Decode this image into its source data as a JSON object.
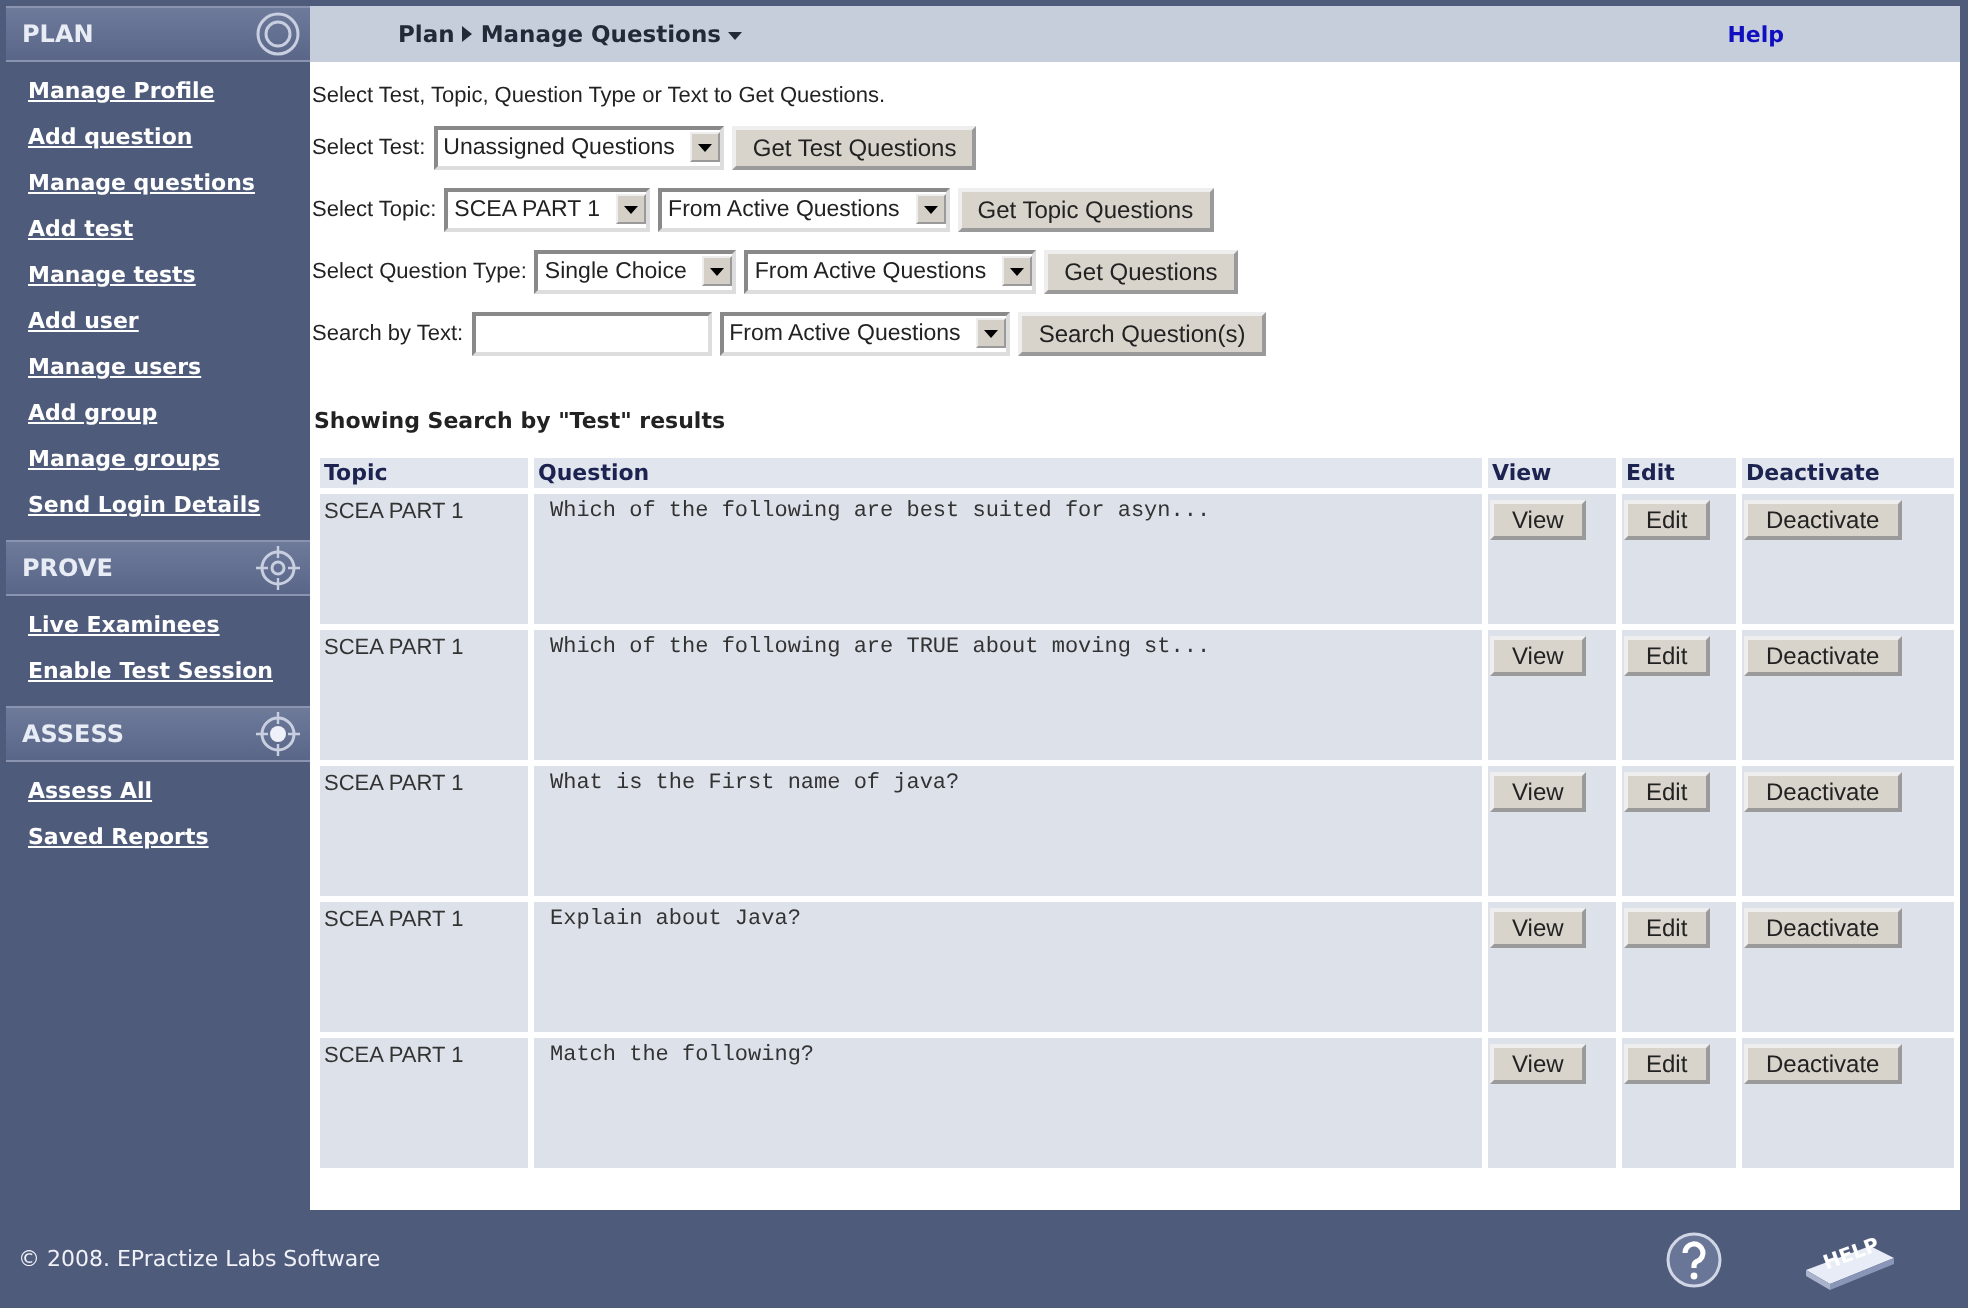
{
  "sidebar": {
    "sections": [
      {
        "title": "PLAN",
        "items": [
          {
            "label": "Manage Profile"
          },
          {
            "label": "Add question"
          },
          {
            "label": "Manage questions"
          },
          {
            "label": "Add test"
          },
          {
            "label": "Manage tests"
          },
          {
            "label": "Add user"
          },
          {
            "label": "Manage users"
          },
          {
            "label": "Add group"
          },
          {
            "label": "Manage groups"
          },
          {
            "label": "Send Login Details"
          }
        ]
      },
      {
        "title": "PROVE",
        "items": [
          {
            "label": "Live Examinees"
          },
          {
            "label": "Enable Test Session"
          }
        ]
      },
      {
        "title": "ASSESS",
        "items": [
          {
            "label": "Assess All"
          },
          {
            "label": "Saved Reports"
          }
        ]
      }
    ]
  },
  "breadcrumb": {
    "parent": "Plan",
    "current": "Manage Questions"
  },
  "help_link": "Help",
  "instructions": "Select Test, Topic, Question Type or Text to Get Questions.",
  "form_rows": [
    {
      "label": "Select Test:",
      "controls": [
        {
          "kind": "select",
          "value": "Unassigned Questions"
        },
        {
          "kind": "button",
          "label": "Get Test Questions"
        }
      ]
    },
    {
      "label": "Select Topic:",
      "controls": [
        {
          "kind": "select",
          "value": "SCEA PART 1"
        },
        {
          "kind": "select",
          "value": "From Active Questions"
        },
        {
          "kind": "button",
          "label": "Get Topic Questions"
        }
      ]
    },
    {
      "label": "Select Question Type:",
      "controls": [
        {
          "kind": "select",
          "value": "Single Choice"
        },
        {
          "kind": "select",
          "value": "From Active Questions"
        },
        {
          "kind": "button",
          "label": "Get Questions"
        }
      ]
    },
    {
      "label": "Search by Text:",
      "controls": [
        {
          "kind": "input"
        },
        {
          "kind": "select",
          "value": "From Active Questions"
        },
        {
          "kind": "button",
          "label": "Search Question(s)"
        }
      ]
    }
  ],
  "results_heading": "Showing Search by \"Test\" results",
  "table": {
    "columns": [
      "Topic",
      "Question",
      "View",
      "Edit",
      "Deactivate"
    ],
    "rows": [
      {
        "topic": "SCEA PART 1",
        "question": "Which of the following are best suited for asyn...",
        "view": "View",
        "edit": "Edit",
        "deactivate": "Deactivate"
      },
      {
        "topic": "SCEA PART 1",
        "question": "Which of the following are TRUE about moving st...",
        "view": "View",
        "edit": "Edit",
        "deactivate": "Deactivate"
      },
      {
        "topic": "SCEA PART 1",
        "question": "What is the First name of java?",
        "view": "View",
        "edit": "Edit",
        "deactivate": "Deactivate"
      },
      {
        "topic": "SCEA PART 1",
        "question": "Explain about Java?",
        "view": "View",
        "edit": "Edit",
        "deactivate": "Deactivate"
      },
      {
        "topic": "SCEA PART 1",
        "question": "Match the following?",
        "view": "View",
        "edit": "Edit",
        "deactivate": "Deactivate"
      }
    ]
  },
  "footer": {
    "copyright": "© 2008. EPractize Labs Software",
    "help_logo": "HELP"
  }
}
